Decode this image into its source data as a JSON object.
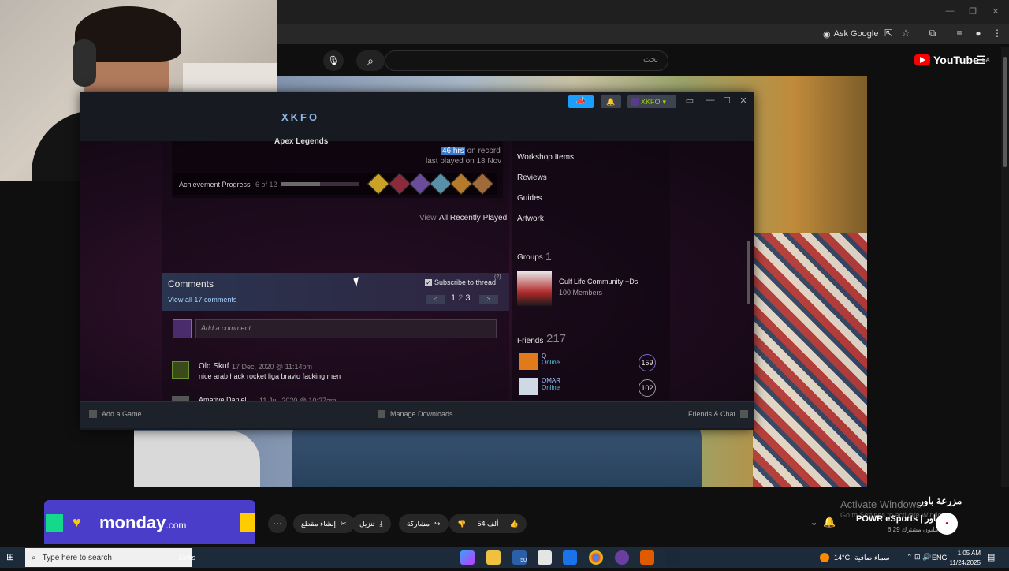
{
  "browser": {
    "toolbar": {
      "ask_google": "Ask Google"
    }
  },
  "youtube": {
    "search_placeholder": "بحث",
    "logo_text": "YouTube",
    "country": "SA",
    "video": {
      "title": "مزرعة باور",
      "channel": "POWR eSports | باور",
      "subscribers": "6.29 مليون مشترك",
      "likes": "54 ألف",
      "share": "مشاركة",
      "download": "تنزيل",
      "clip": "إنشاء مقطع"
    },
    "ad": {
      "brand": "monday",
      "suffix": ".com"
    }
  },
  "windows_watermark": {
    "line1": "Activate Windows",
    "line2": "Go to Settings to activate Windows."
  },
  "steam": {
    "username": "XKFO",
    "account_label": "XKFO",
    "game": {
      "name": "Apex Legends",
      "hours_highlight": "46 hrs",
      "hours_suffix": " on record",
      "last_played": "last played on 18 Nov",
      "achievement_label": "Achievement Progress",
      "achievement_count": "6 of 12",
      "achievement_progress": 0.5
    },
    "view_label": "View",
    "view_all_recent": "All Recently Played",
    "comments": {
      "title": "Comments",
      "view_all": "View all 17 comments",
      "subscribe": "Subscribe to thread",
      "help": "(?)",
      "pages": [
        "1",
        "2",
        "3"
      ],
      "current_page": "2",
      "placeholder": "Add a comment",
      "items": [
        {
          "author": "Old Skuf",
          "date": "17 Dec, 2020 @ 11:14pm",
          "text": "nice arab hack rocket liga bravio facking men"
        },
        {
          "author": "Amative Daniel",
          "date": "11 Jul, 2020 @ 10:27am",
          "text": ""
        }
      ]
    },
    "sidebar": {
      "links": [
        "Workshop Items",
        "Reviews",
        "Guides",
        "Artwork"
      ],
      "groups_title": "Groups",
      "groups_count": "1",
      "group": {
        "name": "Gulf Life Community +Ds",
        "members": "100 Members"
      },
      "friends_title": "Friends",
      "friends_count": "217",
      "friends": [
        {
          "name": "Q",
          "status": "Online",
          "level": "159"
        },
        {
          "name": "OMAR",
          "status": "Online",
          "level": "102"
        }
      ]
    },
    "bottom": {
      "add_game": "Add a Game",
      "manage_downloads": "Manage Downloads",
      "friends_chat": "Friends & Chat"
    }
  },
  "taskbar": {
    "search_placeholder": "Type here to search",
    "links": "Links",
    "weather_temp": "14°C",
    "weather_desc": "سماء صافية",
    "language": "ENG",
    "time": "1:05 AM",
    "date": "11/24/2025",
    "mail_badge": "50"
  }
}
